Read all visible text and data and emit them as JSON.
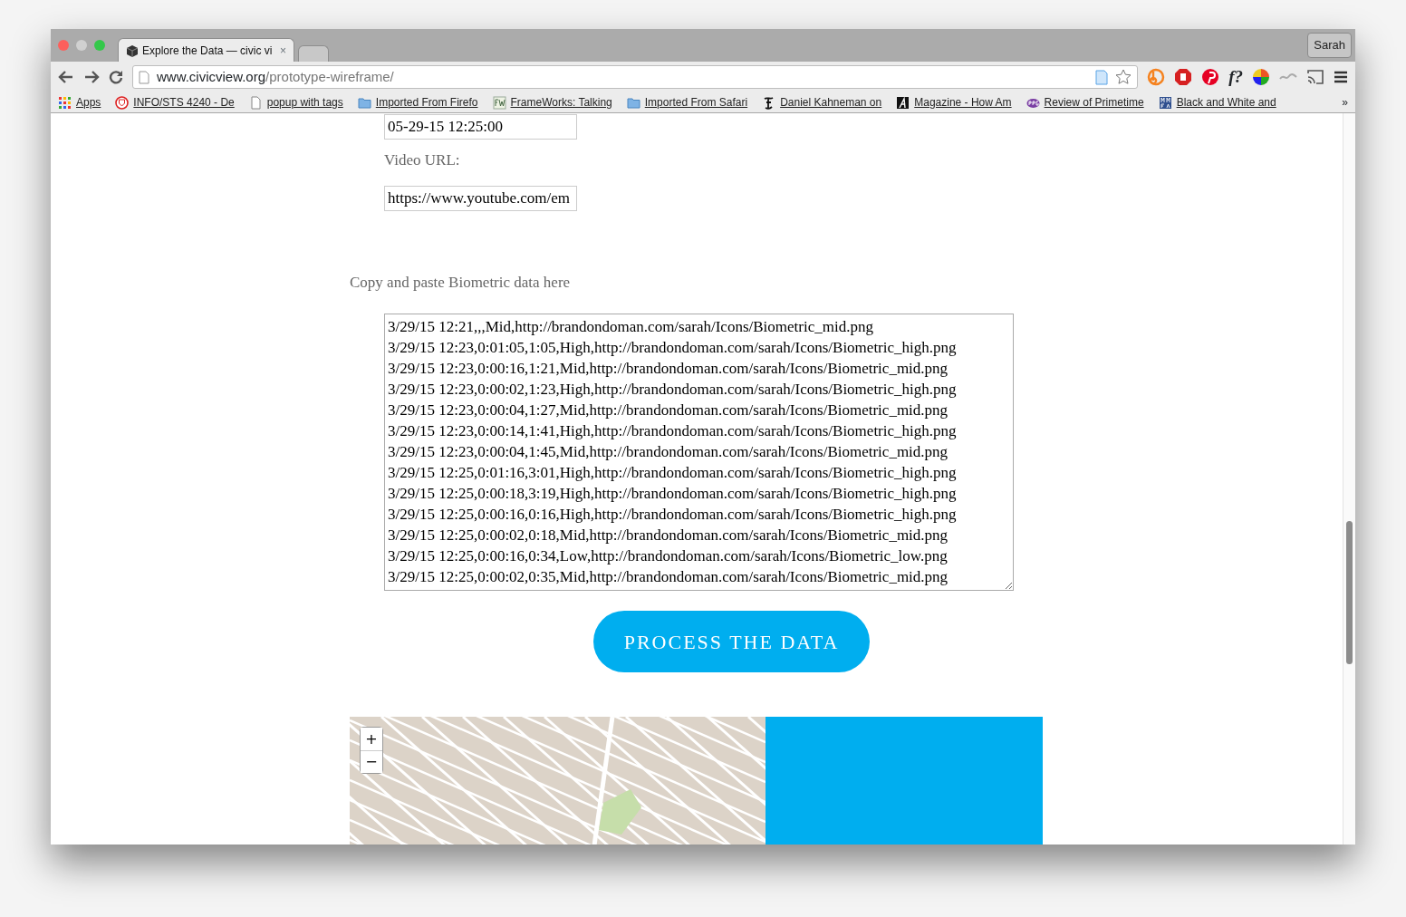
{
  "tabs": [
    {
      "title": "Explore the Data — civic vi",
      "close": "×",
      "selected": true
    },
    {
      "selected": false
    }
  ],
  "profile_button": "Sarah",
  "address_bar": {
    "host": "www.civicview.org",
    "path": "/prototype-wireframe/"
  },
  "extensions": [
    {
      "kind": "b"
    },
    {
      "kind": "stop"
    },
    {
      "kind": "pin"
    },
    {
      "kind": "text",
      "label": "f?"
    },
    {
      "kind": "wheel"
    },
    {
      "kind": "wave"
    },
    {
      "kind": "cast"
    }
  ],
  "bookmarks": [
    {
      "kind": "apps",
      "label": "Apps"
    },
    {
      "kind": "shield",
      "label": "INFO/STS 4240 - De"
    },
    {
      "kind": "page",
      "label": "popup with tags"
    },
    {
      "kind": "folder",
      "label": "Imported From Firefo"
    },
    {
      "kind": "fw",
      "label": "FrameWorks: Talking"
    },
    {
      "kind": "folder",
      "label": "Imported From Safari"
    },
    {
      "kind": "nyt",
      "label": "Daniel Kahneman on"
    },
    {
      "kind": "mag",
      "label": "Magazine - How Am"
    },
    {
      "kind": "rpg",
      "label": "Review of Primetime"
    },
    {
      "kind": "mmfa",
      "label": "Black and White and"
    }
  ],
  "bookmarks_more": "»",
  "form": {
    "date_value": "05-29-15 12:25:00",
    "video_label": "Video URL:",
    "video_value": "https://www.youtube.com/em",
    "biometric_label": "Copy and paste Biometric data here",
    "biometric_lines": [
      "3/29/15 12:21,,,Mid,http://brandondoman.com/sarah/Icons/Biometric_mid.png",
      "3/29/15 12:23,0:01:05,1:05,High,http://brandondoman.com/sarah/Icons/Biometric_high.png",
      "3/29/15 12:23,0:00:16,1:21,Mid,http://brandondoman.com/sarah/Icons/Biometric_mid.png",
      "3/29/15 12:23,0:00:02,1:23,High,http://brandondoman.com/sarah/Icons/Biometric_high.png",
      "3/29/15 12:23,0:00:04,1:27,Mid,http://brandondoman.com/sarah/Icons/Biometric_mid.png",
      "3/29/15 12:23,0:00:14,1:41,High,http://brandondoman.com/sarah/Icons/Biometric_high.png",
      "3/29/15 12:23,0:00:04,1:45,Mid,http://brandondoman.com/sarah/Icons/Biometric_mid.png",
      "3/29/15 12:25,0:01:16,3:01,High,http://brandondoman.com/sarah/Icons/Biometric_high.png",
      "3/29/15 12:25,0:00:18,3:19,High,http://brandondoman.com/sarah/Icons/Biometric_high.png",
      "3/29/15 12:25,0:00:16,0:16,High,http://brandondoman.com/sarah/Icons/Biometric_high.png",
      "3/29/15 12:25,0:00:02,0:18,Mid,http://brandondoman.com/sarah/Icons/Biometric_mid.png",
      "3/29/15 12:25,0:00:16,0:34,Low,http://brandondoman.com/sarah/Icons/Biometric_low.png",
      "3/29/15 12:25,0:00:02,0:35,Mid,http://brandondoman.com/sarah/Icons/Biometric_mid.png"
    ],
    "process_button": "PROCESS THE DATA"
  },
  "map": {
    "kind": "picture",
    "zoom_in": "+",
    "zoom_out": "−"
  }
}
